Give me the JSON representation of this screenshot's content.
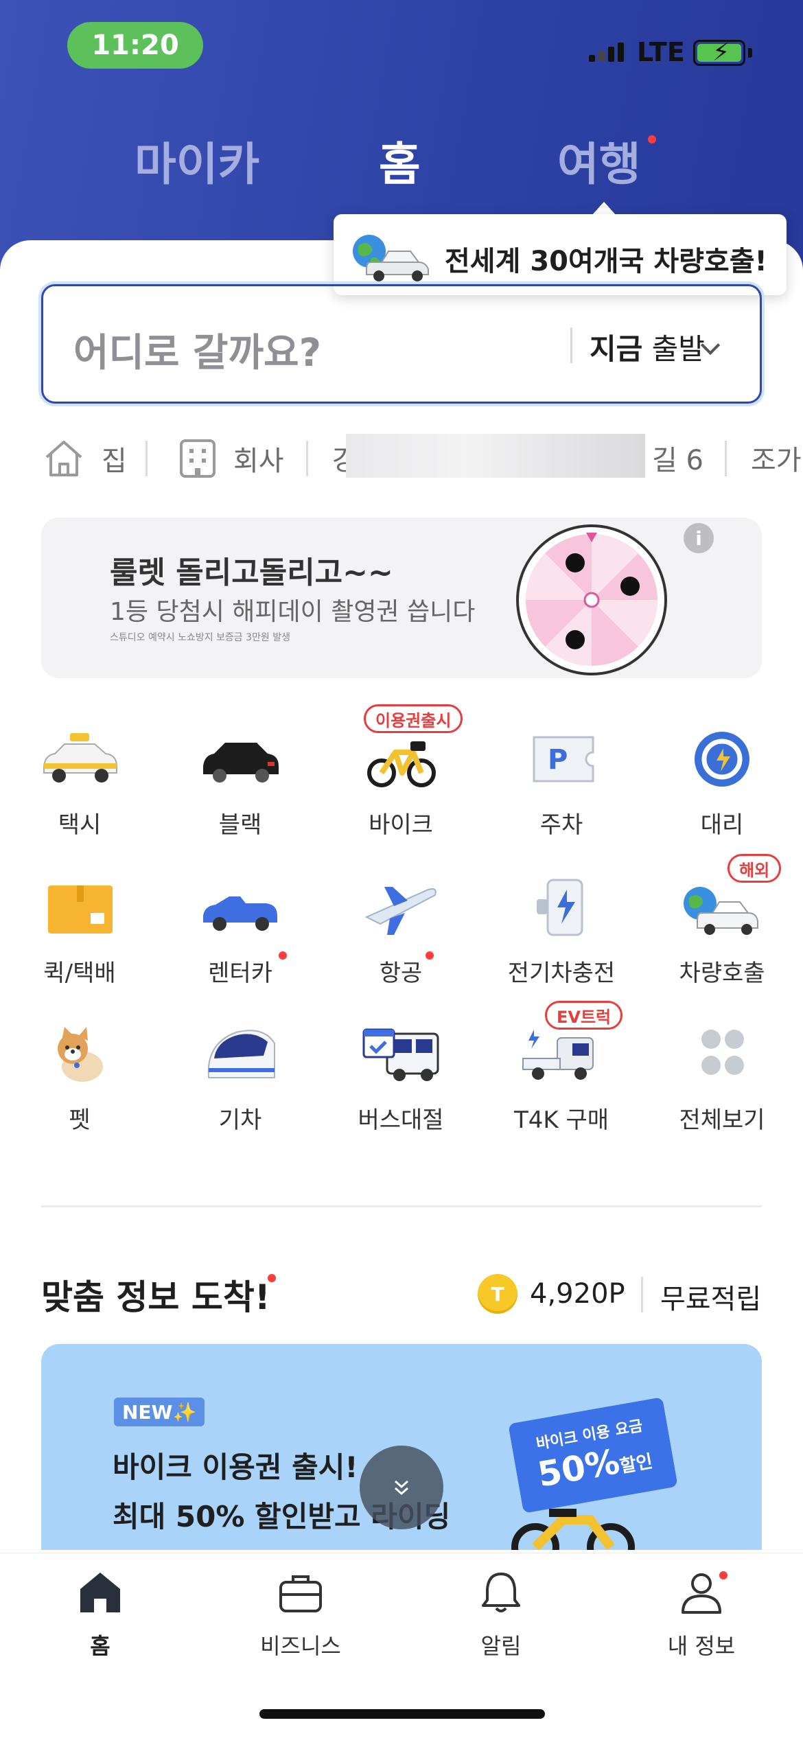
{
  "status_bar": {
    "time": "11:20",
    "network": "LTE"
  },
  "top_tabs": {
    "mycar": "마이카",
    "home": "홈",
    "travel": "여행"
  },
  "tooltip": {
    "text": "전세계 30여개국 차량호출!"
  },
  "search": {
    "placeholder": "어디로 갈까요?",
    "depart_bold": "지금",
    "depart_rest": " 출발"
  },
  "quick": {
    "home": "집",
    "work": "회사",
    "address_start": "강",
    "address_end": "길 6",
    "next": "조가"
  },
  "roulette": {
    "title": "룰렛 돌리고돌리고~~",
    "subtitle": "1등 당첨시 해피데이 촬영권 씁니다",
    "fine_print": "스튜디오 예약시 노쇼방지 보증금 3만원 발생",
    "info": "i"
  },
  "services": [
    {
      "label": "택시"
    },
    {
      "label": "블랙"
    },
    {
      "label": "바이크",
      "badge": "이용권출시"
    },
    {
      "label": "주차"
    },
    {
      "label": "대리"
    },
    {
      "label": "퀵/택배"
    },
    {
      "label": "렌터카"
    },
    {
      "label": "항공"
    },
    {
      "label": "전기차충전"
    },
    {
      "label": "차량호출",
      "badge": "해외"
    },
    {
      "label": "펫"
    },
    {
      "label": "기차"
    },
    {
      "label": "버스대절"
    },
    {
      "label": "T4K 구매",
      "badge": "EV트럭"
    },
    {
      "label": "전체보기"
    }
  ],
  "custom_info": {
    "title": "맞춤 정보 도착!",
    "coin": "T",
    "points": "4,920P",
    "free_earn": "무료적립"
  },
  "promo": {
    "new_badge": "NEW✨",
    "line1": "바이크 이용권 출시!",
    "line2": "최대 50% 할인받고 라이딩",
    "ticket_top": "바이크 이용 요금",
    "ticket_pct": "50%",
    "ticket_off": "할인"
  },
  "bottom_nav": {
    "home": "홈",
    "business": "비즈니스",
    "alerts": "알림",
    "my_info": "내 정보"
  },
  "colors": {
    "header": "#2e43a6",
    "accent": "#2f46b0",
    "red_dot": "#ff3b3b",
    "promo_bg": "#a9d3f8"
  }
}
